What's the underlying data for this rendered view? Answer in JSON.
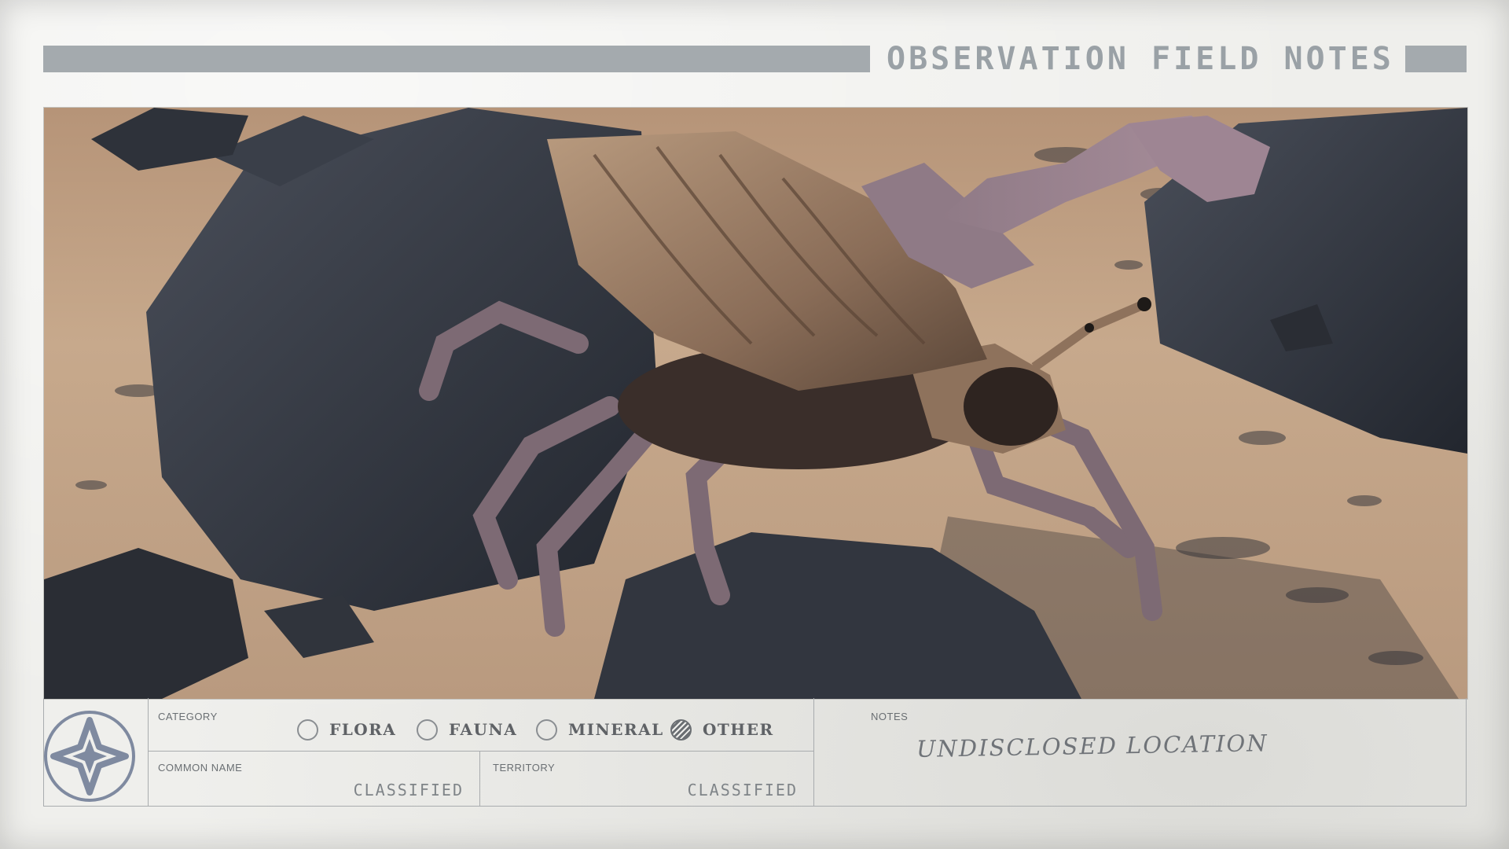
{
  "header": {
    "title": "OBSERVATION FIELD NOTES"
  },
  "category": {
    "label": "CATEGORY",
    "options": [
      {
        "label": "FLORA",
        "selected": false
      },
      {
        "label": "FAUNA",
        "selected": false
      },
      {
        "label": "MINERAL",
        "selected": false
      },
      {
        "label": "OTHER",
        "selected": true
      }
    ]
  },
  "common_name": {
    "label": "COMMON NAME",
    "value": "CLASSIFIED"
  },
  "territory": {
    "label": "TERRITORY",
    "value": "CLASSIFIED"
  },
  "notes": {
    "label": "NOTES",
    "value": "UNDISCLOSED LOCATION"
  },
  "emblem": {
    "icon": "star-compass-emblem"
  },
  "photo": {
    "subject": "creature-photo"
  }
}
